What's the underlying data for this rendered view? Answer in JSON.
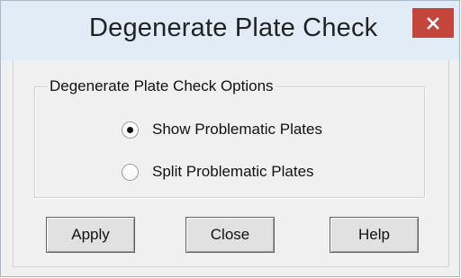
{
  "window": {
    "title": "Degenerate Plate Check",
    "close_icon": "close-icon",
    "titlebar_color": "#e1ecf6",
    "close_color": "#c5453a"
  },
  "options_group": {
    "legend": "Degenerate Plate Check Options",
    "radios": [
      {
        "label": "Show Problematic Plates",
        "selected": true
      },
      {
        "label": "Split Problematic Plates",
        "selected": false
      }
    ]
  },
  "buttons": {
    "apply_label": "Apply",
    "close_label": "Close",
    "help_label": "Help"
  }
}
